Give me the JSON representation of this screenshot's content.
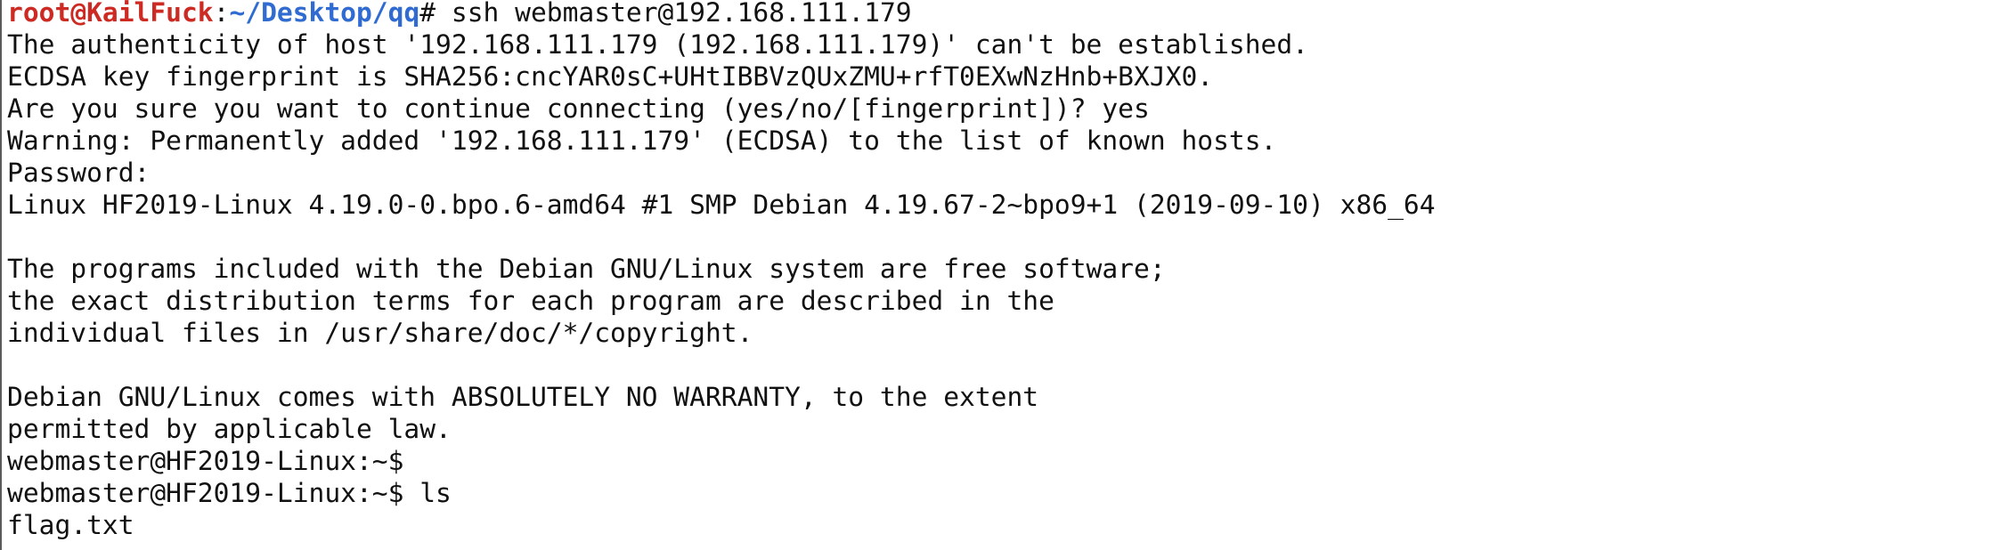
{
  "terminal": {
    "lines": [
      {
        "segments": [
          {
            "text": "root@KailFuck",
            "style": "user"
          },
          {
            "text": ":",
            "style": "plain"
          },
          {
            "text": "~/Desktop/qq",
            "style": "path"
          },
          {
            "text": "# ssh webmaster@192.168.111.179",
            "style": "plain"
          }
        ]
      },
      {
        "segments": [
          {
            "text": "The authenticity of host '192.168.111.179 (192.168.111.179)' can't be established.",
            "style": "plain"
          }
        ]
      },
      {
        "segments": [
          {
            "text": "ECDSA key fingerprint is SHA256:cncYAR0sC+UHtIBBVzQUxZMU+rfT0EXwNzHnb+BXJX0.",
            "style": "plain"
          }
        ]
      },
      {
        "segments": [
          {
            "text": "Are you sure you want to continue connecting (yes/no/[fingerprint])? yes",
            "style": "plain"
          }
        ]
      },
      {
        "segments": [
          {
            "text": "Warning: Permanently added '192.168.111.179' (ECDSA) to the list of known hosts.",
            "style": "plain"
          }
        ]
      },
      {
        "segments": [
          {
            "text": "Password:",
            "style": "plain"
          }
        ]
      },
      {
        "segments": [
          {
            "text": "Linux HF2019-Linux 4.19.0-0.bpo.6-amd64 #1 SMP Debian 4.19.67-2~bpo9+1 (2019-09-10) x86_64",
            "style": "plain"
          }
        ]
      },
      {
        "segments": [
          {
            "text": "",
            "style": "plain"
          }
        ]
      },
      {
        "segments": [
          {
            "text": "The programs included with the Debian GNU/Linux system are free software;",
            "style": "plain"
          }
        ]
      },
      {
        "segments": [
          {
            "text": "the exact distribution terms for each program are described in the",
            "style": "plain"
          }
        ]
      },
      {
        "segments": [
          {
            "text": "individual files in /usr/share/doc/*/copyright.",
            "style": "plain"
          }
        ]
      },
      {
        "segments": [
          {
            "text": "",
            "style": "plain"
          }
        ]
      },
      {
        "segments": [
          {
            "text": "Debian GNU/Linux comes with ABSOLUTELY NO WARRANTY, to the extent",
            "style": "plain"
          }
        ]
      },
      {
        "segments": [
          {
            "text": "permitted by applicable law.",
            "style": "plain"
          }
        ]
      },
      {
        "segments": [
          {
            "text": "webmaster@HF2019-Linux:~$",
            "style": "plain"
          }
        ]
      },
      {
        "segments": [
          {
            "text": "webmaster@HF2019-Linux:~$ ls",
            "style": "plain"
          }
        ]
      },
      {
        "segments": [
          {
            "text": "flag.txt",
            "style": "plain"
          }
        ]
      }
    ]
  },
  "colors": {
    "background": "#ffffff",
    "text": "#111111",
    "prompt_user": "#cc2a22",
    "prompt_path": "#2f6bd0"
  }
}
